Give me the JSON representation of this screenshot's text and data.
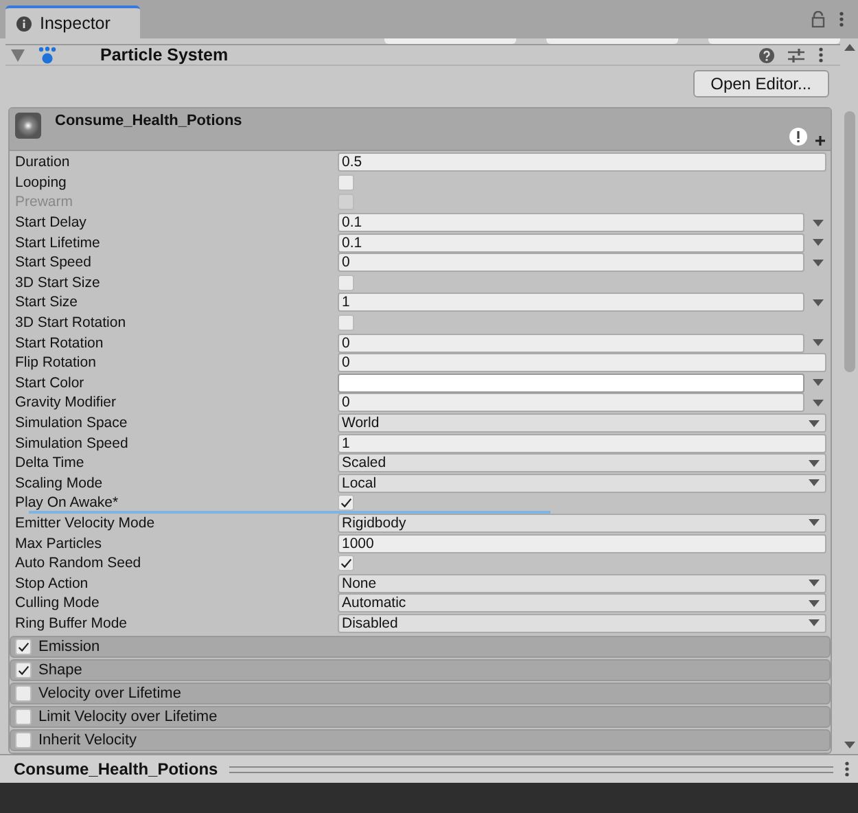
{
  "tab": {
    "label": "Inspector",
    "selected": true
  },
  "component": {
    "title": "Particle System",
    "expanded": true,
    "open_editor_button": "Open Editor..."
  },
  "system": {
    "name": "Consume_Health_Potions"
  },
  "properties": [
    {
      "label": "Duration",
      "kind": "number",
      "value": "0.5",
      "disabled": false,
      "insertion_line": false
    },
    {
      "label": "Looping",
      "kind": "checkbox",
      "checked": false,
      "disabled": false,
      "insertion_line": false
    },
    {
      "label": "Prewarm",
      "kind": "checkbox",
      "checked": false,
      "disabled": true,
      "insertion_line": false
    },
    {
      "label": "Start Delay",
      "kind": "curve",
      "value": "0.1",
      "disabled": false,
      "insertion_line": false
    },
    {
      "label": "Start Lifetime",
      "kind": "curve",
      "value": "0.1",
      "disabled": false,
      "insertion_line": false
    },
    {
      "label": "Start Speed",
      "kind": "curve",
      "value": "0",
      "disabled": false,
      "insertion_line": false
    },
    {
      "label": "3D Start Size",
      "kind": "checkbox",
      "checked": false,
      "disabled": false,
      "insertion_line": false
    },
    {
      "label": "Start Size",
      "kind": "curve",
      "value": "1",
      "disabled": false,
      "insertion_line": false
    },
    {
      "label": "3D Start Rotation",
      "kind": "checkbox",
      "checked": false,
      "disabled": false,
      "insertion_line": false
    },
    {
      "label": "Start Rotation",
      "kind": "curve",
      "value": "0",
      "disabled": false,
      "insertion_line": false
    },
    {
      "label": "Flip Rotation",
      "kind": "number",
      "value": "0",
      "disabled": false,
      "insertion_line": false
    },
    {
      "label": "Start Color",
      "kind": "color",
      "color": "#ffffff",
      "disabled": false,
      "insertion_line": false
    },
    {
      "label": "Gravity Modifier",
      "kind": "curve",
      "value": "0",
      "disabled": false,
      "insertion_line": false
    },
    {
      "label": "Simulation Space",
      "kind": "enum",
      "value": "World",
      "disabled": false,
      "insertion_line": false
    },
    {
      "label": "Simulation Speed",
      "kind": "number",
      "value": "1",
      "disabled": false,
      "insertion_line": false
    },
    {
      "label": "Delta Time",
      "kind": "enum",
      "value": "Scaled",
      "disabled": false,
      "insertion_line": false
    },
    {
      "label": "Scaling Mode",
      "kind": "enum",
      "value": "Local",
      "disabled": false,
      "insertion_line": false
    },
    {
      "label": "Play On Awake*",
      "kind": "checkbox",
      "checked": true,
      "disabled": false,
      "insertion_line": true
    },
    {
      "label": "Emitter Velocity Mode",
      "kind": "enum",
      "value": "Rigidbody",
      "disabled": false,
      "insertion_line": false
    },
    {
      "label": "Max Particles",
      "kind": "number",
      "value": "1000",
      "disabled": false,
      "insertion_line": false
    },
    {
      "label": "Auto Random Seed",
      "kind": "checkbox",
      "checked": true,
      "disabled": false,
      "insertion_line": false
    },
    {
      "label": "Stop Action",
      "kind": "enum",
      "value": "None",
      "disabled": false,
      "insertion_line": false
    },
    {
      "label": "Culling Mode",
      "kind": "enum",
      "value": "Automatic",
      "disabled": false,
      "insertion_line": false
    },
    {
      "label": "Ring Buffer Mode",
      "kind": "enum",
      "value": "Disabled",
      "disabled": false,
      "insertion_line": false
    }
  ],
  "modules": [
    {
      "label": "Emission",
      "checked": true
    },
    {
      "label": "Shape",
      "checked": true
    },
    {
      "label": "Velocity over Lifetime",
      "checked": false
    },
    {
      "label": "Limit Velocity over Lifetime",
      "checked": false
    },
    {
      "label": "Inherit Velocity",
      "checked": false
    }
  ],
  "footer": {
    "title": "Consume_Health_Potions"
  }
}
